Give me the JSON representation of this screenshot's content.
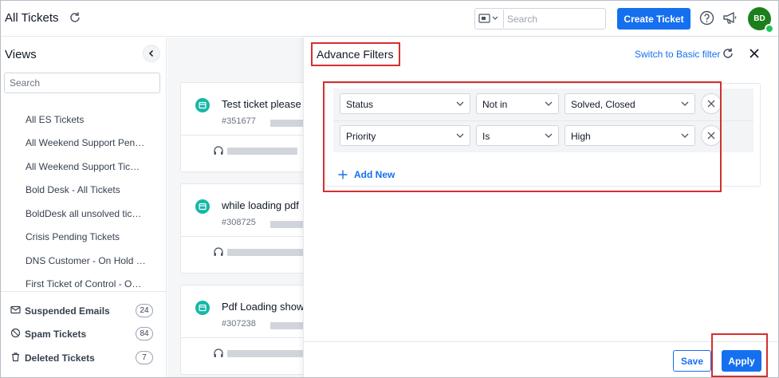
{
  "header": {
    "title": "All Tickets",
    "search_placeholder": "Search",
    "create_label": "Create Ticket",
    "avatar_initials": "BD"
  },
  "sidebar": {
    "title": "Views",
    "search_placeholder": "Search",
    "views": [
      "All ES Tickets",
      "All Weekend Support Pen…",
      "All Weekend Support Tic…",
      "Bold Desk - All Tickets",
      "BoldDesk all unsolved tic…",
      "Crisis Pending Tickets",
      "DNS Customer - On Hold …",
      "First Ticket of Control - O…"
    ],
    "special": [
      {
        "label": "Suspended Emails",
        "count": "24"
      },
      {
        "label": "Spam Tickets",
        "count": "84"
      },
      {
        "label": "Deleted Tickets",
        "count": "7"
      }
    ]
  },
  "tickets": [
    {
      "title": "Test ticket please",
      "id": "#351677"
    },
    {
      "title": "while loading pdf",
      "id": "#308725"
    },
    {
      "title": "Pdf Loading show",
      "id": "#307238"
    }
  ],
  "filter_panel": {
    "title": "Advance Filters",
    "switch_label": "Switch to Basic filter",
    "rows": [
      {
        "field": "Status",
        "operator": "Not in",
        "value": "Solved, Closed"
      },
      {
        "field": "Priority",
        "operator": "Is",
        "value": "High"
      }
    ],
    "add_new_label": "Add New",
    "save_label": "Save",
    "apply_label": "Apply"
  },
  "colors": {
    "accent": "#1570ef",
    "highlight": "#d32f2f",
    "avatar": "#1b7f1b",
    "ticket_icon": "#14b8a6"
  }
}
